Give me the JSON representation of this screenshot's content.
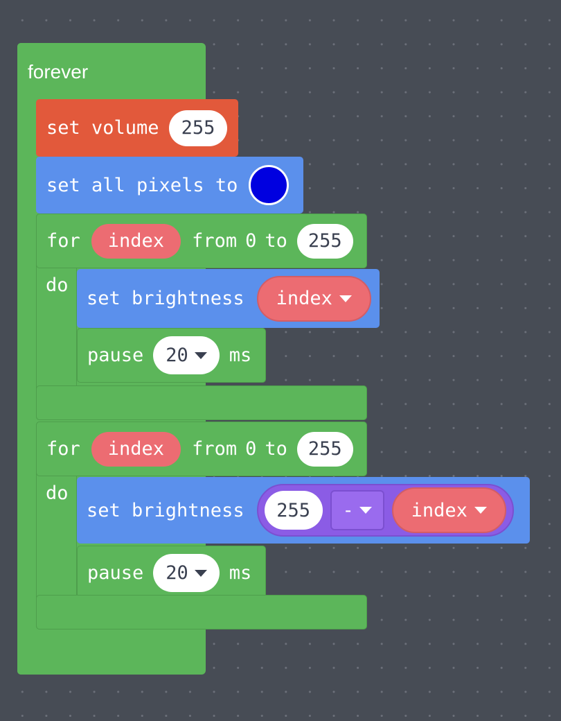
{
  "workspace": {
    "background_color": "#474C55",
    "dot_color": "#6C707A"
  },
  "program": {
    "root_block": {
      "name": "forever",
      "label": "forever",
      "color": "#5CB65A"
    },
    "statements": [
      {
        "name": "set-volume",
        "label": "set volume",
        "color": "#E2593B",
        "value": "255"
      },
      {
        "name": "set-all-pixels-to",
        "label": "set all pixels to",
        "color": "#5B90EC",
        "swatch_color": "#0000E0"
      },
      {
        "name": "for-loop-1",
        "color": "#5CB65A",
        "for_label": "for",
        "variable": "index",
        "from_label": "from",
        "from_value": "0",
        "to_label": "to",
        "to_value": "255",
        "do_label": "do",
        "body": [
          {
            "name": "set-brightness-1",
            "label": "set brightness",
            "color": "#5B90EC",
            "argument_variable": "index"
          },
          {
            "name": "pause-1",
            "label": "pause",
            "color": "#5CB65A",
            "value": "20",
            "unit": "ms"
          }
        ]
      },
      {
        "name": "for-loop-2",
        "color": "#5CB65A",
        "for_label": "for",
        "variable": "index",
        "from_label": "from",
        "from_value": "0",
        "to_label": "to",
        "to_value": "255",
        "do_label": "do",
        "body": [
          {
            "name": "set-brightness-2",
            "label": "set brightness",
            "color": "#5B90EC",
            "operator": {
              "name": "subtract-operator",
              "color": "#8B5CE5",
              "left_value": "255",
              "operator_symbol": "-",
              "right_variable": "index"
            }
          },
          {
            "name": "pause-2",
            "label": "pause",
            "color": "#5CB65A",
            "value": "20",
            "unit": "ms"
          }
        ]
      }
    ]
  }
}
